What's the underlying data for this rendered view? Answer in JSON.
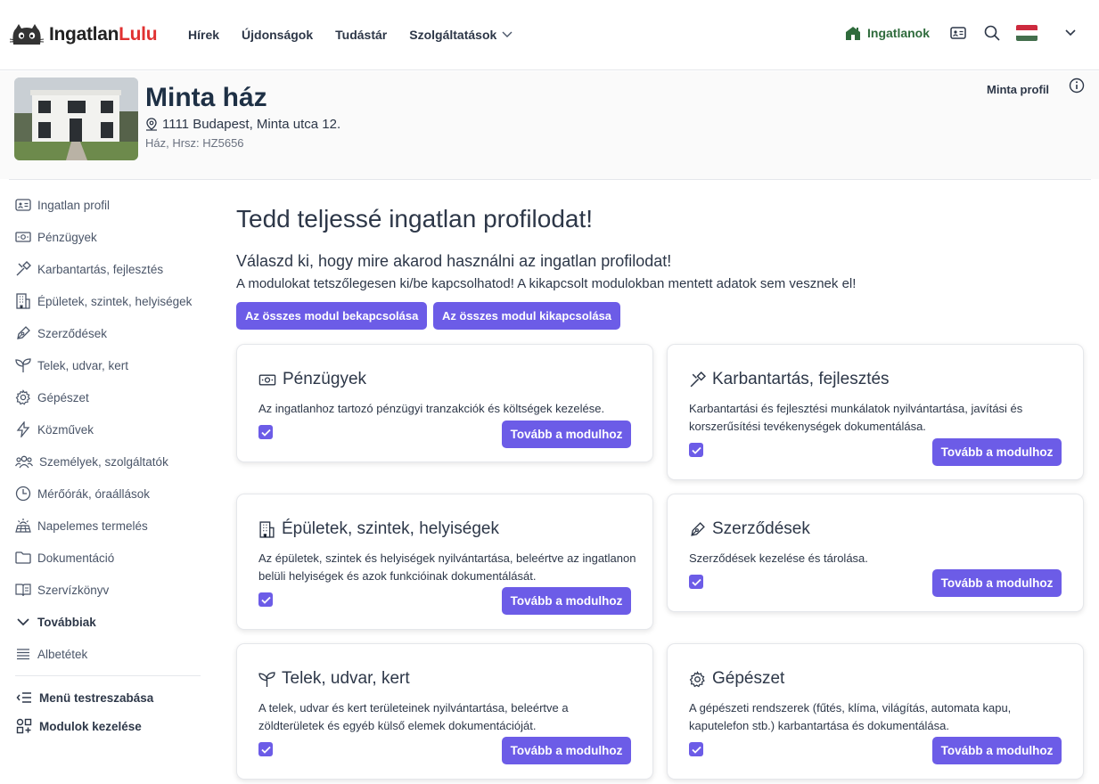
{
  "brand": {
    "name_part1": "Ingatlan",
    "name_part2": "Lulu",
    "accent": "#6c5ce7",
    "accent_red": "#e03131"
  },
  "nav": {
    "links": [
      "Hírek",
      "Újdonságok",
      "Tudástár",
      "Szolgáltatások"
    ],
    "ingatlanok": "Ingatlanok"
  },
  "property": {
    "title": "Minta ház",
    "address": "1111 Budapest, Minta utca 12.",
    "subtitle": "Ház, Hrsz: HZ5656",
    "profile_label": "Minta profil"
  },
  "sidebar": {
    "items": [
      {
        "label": "Ingatlan profil",
        "icon": "id-card-icon"
      },
      {
        "label": "Pénzügyek",
        "icon": "money-icon"
      },
      {
        "label": "Karbantartás, fejlesztés",
        "icon": "tools-icon"
      },
      {
        "label": "Épületek, szintek, helyiségek",
        "icon": "building-icon"
      },
      {
        "label": "Szerződések",
        "icon": "pen-icon"
      },
      {
        "label": "Telek, udvar, kert",
        "icon": "sprout-icon"
      },
      {
        "label": "Gépészet",
        "icon": "gear-icon"
      },
      {
        "label": "Közművek",
        "icon": "bolt-icon"
      },
      {
        "label": "Személyek, szolgáltatók",
        "icon": "people-icon"
      },
      {
        "label": "Mérőórák, óraállások",
        "icon": "clock-icon"
      },
      {
        "label": "Napelemes termelés",
        "icon": "solar-icon"
      },
      {
        "label": "Dokumentáció",
        "icon": "folder-icon"
      },
      {
        "label": "Szervízkönyv",
        "icon": "book-icon"
      },
      {
        "label": "Továbbiak",
        "icon": "chevron-down-icon"
      },
      {
        "label": "Albetétek",
        "icon": "list-icon"
      }
    ],
    "customize_menu": "Menü testreszabása",
    "manage_modules": "Modulok kezelése"
  },
  "main": {
    "heading": "Tedd teljessé ingatlan profilodat!",
    "lead": "Válaszd ki, hogy mire akarod használni az ingatlan profilodat!",
    "lead2": "A modulokat tetszőlegesen ki/be kapcsolhatod! A kikapcsolt modulokban mentett adatok sem vesznek el!",
    "enable_all": "Az összes modul bekapcsolása",
    "disable_all": "Az összes modul kikapcsolása",
    "cards": [
      {
        "title": "Pénzügyek",
        "desc": "Az ingatlanhoz tartozó pénzügyi tranzakciók és költségek kezelése.",
        "checked": true,
        "button": "Tovább a modulhoz"
      },
      {
        "title": "Karbantartás, fejlesztés",
        "desc": "Karbantartási és fejlesztési munkálatok nyilvántartása, javítási és korszerűsítési tevékenységek dokumentálása.",
        "checked": true,
        "button": "Tovább a modulhoz"
      },
      {
        "title": "Épületek, szintek, helyiségek",
        "desc": "Az épületek, szintek és helyiségek nyilvántartása, beleértve az ingatlanon belüli helyiségek és azok funkcióinak dokumentálását.",
        "checked": true,
        "button": "Tovább a modulhoz"
      },
      {
        "title": "Szerződések",
        "desc": "Szerződések kezelése és tárolása.",
        "checked": true,
        "button": "Tovább a modulhoz"
      },
      {
        "title": "Telek, udvar, kert",
        "desc": "A telek, udvar és kert területeinek nyilvántartása, beleértve a zöldterületek és egyéb külső elemek dokumentációját.",
        "checked": true,
        "button": "Tovább a modulhoz"
      },
      {
        "title": "Gépészet",
        "desc": "A gépészeti rendszerek (fűtés, klíma, világítás, automata kapu, kaputelefon stb.) karbantartása és dokumentálása.",
        "checked": true,
        "button": "Tovább a modulhoz"
      }
    ]
  }
}
